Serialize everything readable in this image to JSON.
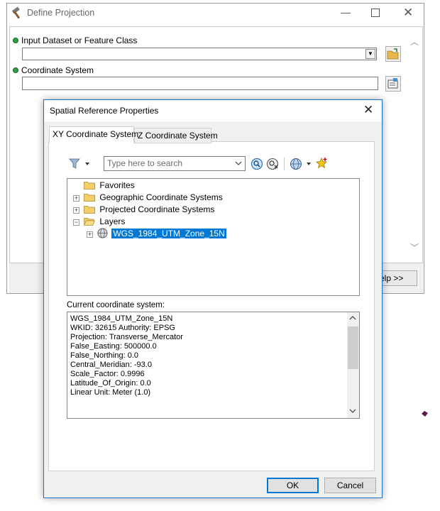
{
  "define_projection": {
    "title": "Define Projection",
    "input_label": "Input Dataset or Feature Class",
    "input_value": "",
    "coord_label": "Coordinate System",
    "coord_value": "",
    "help_button": "elp >>"
  },
  "srp": {
    "title": "Spatial Reference Properties",
    "tabs": [
      "XY Coordinate System",
      "Z Coordinate System"
    ],
    "active_tab": "XY Coordinate System",
    "search_placeholder": "Type here to search",
    "tree": [
      {
        "label": "Favorites",
        "expander": "none"
      },
      {
        "label": "Geographic Coordinate Systems",
        "expander": "plus"
      },
      {
        "label": "Projected Coordinate Systems",
        "expander": "plus"
      },
      {
        "label": "Layers",
        "expander": "minus"
      },
      {
        "label": "WGS_1984_UTM_Zone_15N",
        "expander": "plus",
        "selected": true
      }
    ],
    "current_label": "Current coordinate system:",
    "current_lines": [
      "WGS_1984_UTM_Zone_15N",
      "WKID: 32615 Authority: EPSG",
      "",
      "Projection: Transverse_Mercator",
      "False_Easting: 500000.0",
      "False_Northing: 0.0",
      "Central_Meridian: -93.0",
      "Scale_Factor: 0.9996",
      "Latitude_Of_Origin: 0.0",
      "Linear Unit: Meter (1.0)"
    ],
    "ok_button": "OK",
    "cancel_button": "Cancel"
  },
  "colors": {
    "accent": "#0078d7",
    "required_dot": "#2ea043",
    "dialog_border": "#1a73c8"
  }
}
